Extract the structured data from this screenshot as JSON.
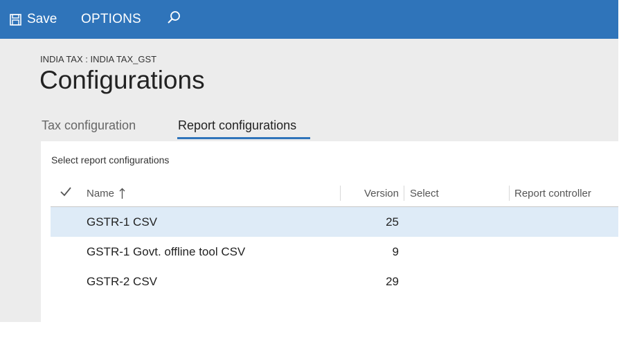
{
  "actionbar": {
    "save_label": "Save",
    "options_label": "OPTIONS",
    "icons": {
      "save": "save-icon",
      "search": "search-icon"
    },
    "color": "#2f74ba"
  },
  "page": {
    "breadcrumb": "INDIA TAX : INDIA TAX_GST",
    "title": "Configurations"
  },
  "tabs": [
    {
      "label": "Tax configuration",
      "active": false
    },
    {
      "label": "Report configurations",
      "active": true
    }
  ],
  "grid": {
    "section_label": "Select report configurations",
    "columns": {
      "name": "Name",
      "version": "Version",
      "select": "Select",
      "report_controller": "Report controller",
      "sort_icon": "sort-ascending-icon",
      "check_icon": "checkmark-icon"
    },
    "rows": [
      {
        "name": "GSTR-1 CSV",
        "version": "25",
        "select": "",
        "report_controller": "",
        "selected": true
      },
      {
        "name": "GSTR-1 Govt. offline tool CSV",
        "version": "9",
        "select": "",
        "report_controller": "",
        "selected": false
      },
      {
        "name": "GSTR-2 CSV",
        "version": "29",
        "select": "",
        "report_controller": "",
        "selected": false
      }
    ],
    "selected_row_color": "#deebf7"
  }
}
